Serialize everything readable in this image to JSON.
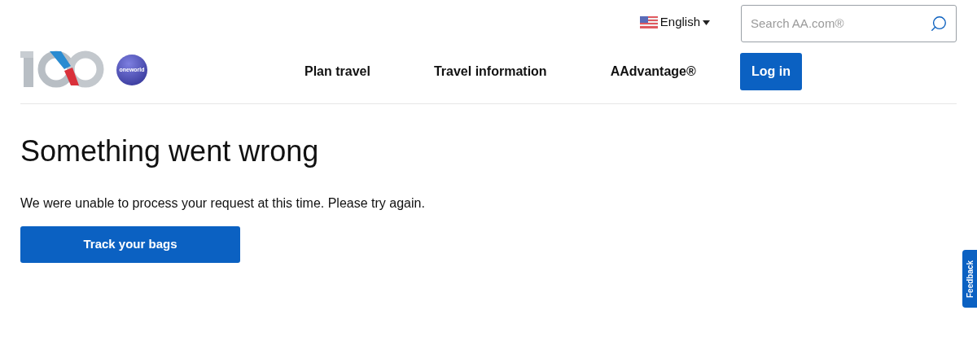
{
  "header": {
    "logo_badge": "oneworld",
    "language": "English",
    "search": {
      "placeholder": "Search AA.com®"
    },
    "nav": [
      "Plan travel",
      "Travel information",
      "AAdvantage®"
    ],
    "login": "Log in"
  },
  "error": {
    "title": "Something went wrong",
    "message": "We were unable to process your request at this time. Please try again.",
    "button": "Track your bags"
  },
  "feedback_tab": "Feedback"
}
